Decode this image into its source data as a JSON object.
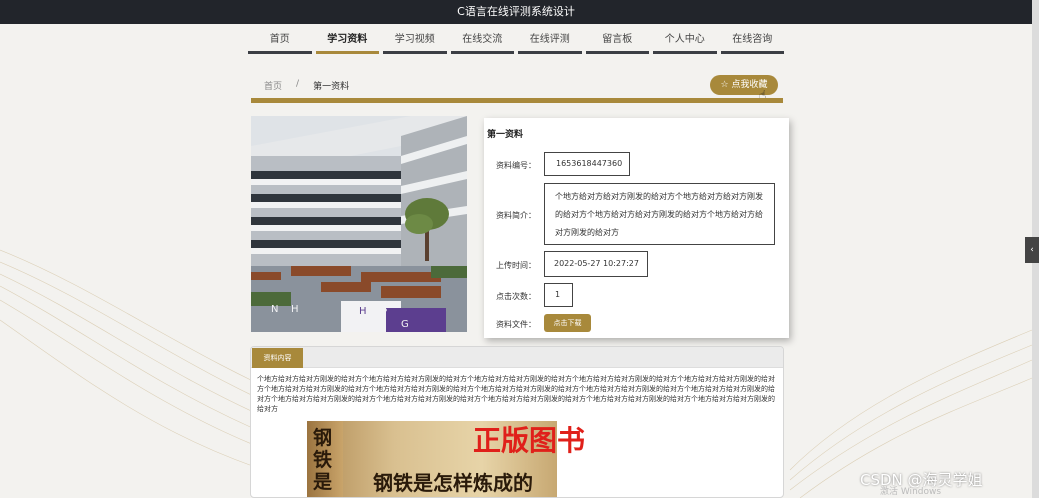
{
  "app": {
    "title": "C语言在线评测系统设计"
  },
  "nav": {
    "items": [
      {
        "label": "首页"
      },
      {
        "label": "学习资料"
      },
      {
        "label": "学习视频"
      },
      {
        "label": "在线交流"
      },
      {
        "label": "在线评测"
      },
      {
        "label": "留言板"
      },
      {
        "label": "个人中心"
      },
      {
        "label": "在线咨询"
      }
    ],
    "active_index": 1
  },
  "breadcrumb": {
    "home": "首页",
    "separator": "/",
    "current": "第一资料"
  },
  "favorite_button": {
    "label": "☆ 点我收藏"
  },
  "side_tab": {
    "label": "‹"
  },
  "detail": {
    "title": "第一资料",
    "id_label": "资料编号：",
    "id_value": "1653618447360",
    "intro_label": "资料简介：",
    "intro_value": "个地方给对方给对方刚发的给对方个地方给对方给对方刚发的给对方个地方给对方给对方刚发的给对方个地方给对方给对方刚发的给对方",
    "upload_label": "上传时间：",
    "upload_value": "2022-05-27 10:27:27",
    "clicks_label": "点击次数：",
    "clicks_value": "1",
    "file_label": "资料文件：",
    "download_label": "点击下载"
  },
  "content": {
    "tab_label": "资料内容",
    "text": "个地方给对方给对方刚发的给对方个地方给对方给对方刚发的给对方个地方给对方给对方刚发的给对方个地方给对方给对方刚发的给对方个地方给对方给对方刚发的给对方个地方给对方给对方刚发的给对方个地方给对方给对方刚发的给对方个地方给对方给对方刚发的给对方个地方给对方给对方刚发的给对方个地方给对方给对方刚发的给对方个地方给对方给对方刚发的给对方个地方给对方给对方刚发的给对方个地方给对方给对方刚发的给对方个地方给对方给对方刚发的给对方个地方给对方给对方刚发的给对方",
    "book_spine": "钢铁是",
    "book_title": "钢铁是怎样炼成的",
    "promo": "正版图书"
  },
  "watermarks": {
    "csdn": "CSDN @海灵学姐",
    "windows": "激活 Windows"
  },
  "colors": {
    "accent": "#a8893b",
    "topbar": "#22252b",
    "nav_underline": "#3b3e44"
  }
}
